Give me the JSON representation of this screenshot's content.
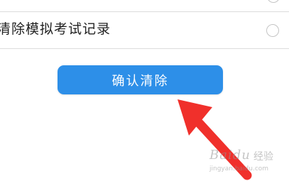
{
  "options": [
    {
      "label": "",
      "selected": false
    },
    {
      "label": "清除模拟考试记录",
      "selected": false
    }
  ],
  "confirm_button": {
    "label": "确认清除",
    "color": "#2d8fe8"
  },
  "annotation": {
    "arrow_color": "#f0302b"
  },
  "watermark": {
    "brand": "Baidu",
    "brand_cn": "经验",
    "url": "jingyan.baidu.com"
  }
}
